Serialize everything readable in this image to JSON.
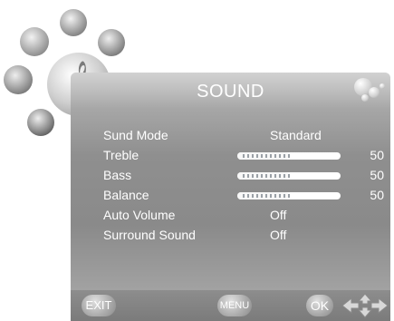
{
  "menu": {
    "title": "SOUND",
    "rows": [
      {
        "label": "Sund Mode",
        "value": "Standard"
      },
      {
        "label": "Treble",
        "level": 50,
        "value": "50"
      },
      {
        "label": "Bass",
        "level": 50,
        "value": "50"
      },
      {
        "label": "Balance",
        "level": 50,
        "value": "50"
      },
      {
        "label": "Auto Volume",
        "value": "Off"
      },
      {
        "label": "Surround Sound",
        "value": "Off"
      }
    ]
  },
  "footer": {
    "exit_label": "EXIT",
    "menu_label": "MENU",
    "ok_label": "OK"
  },
  "icons": [
    "picture-icon",
    "setup-icon",
    "channel-icon",
    "sound-icon",
    "lock-icon",
    "clef-icon",
    "nav-arrows-icon",
    "bubbles-icon"
  ]
}
